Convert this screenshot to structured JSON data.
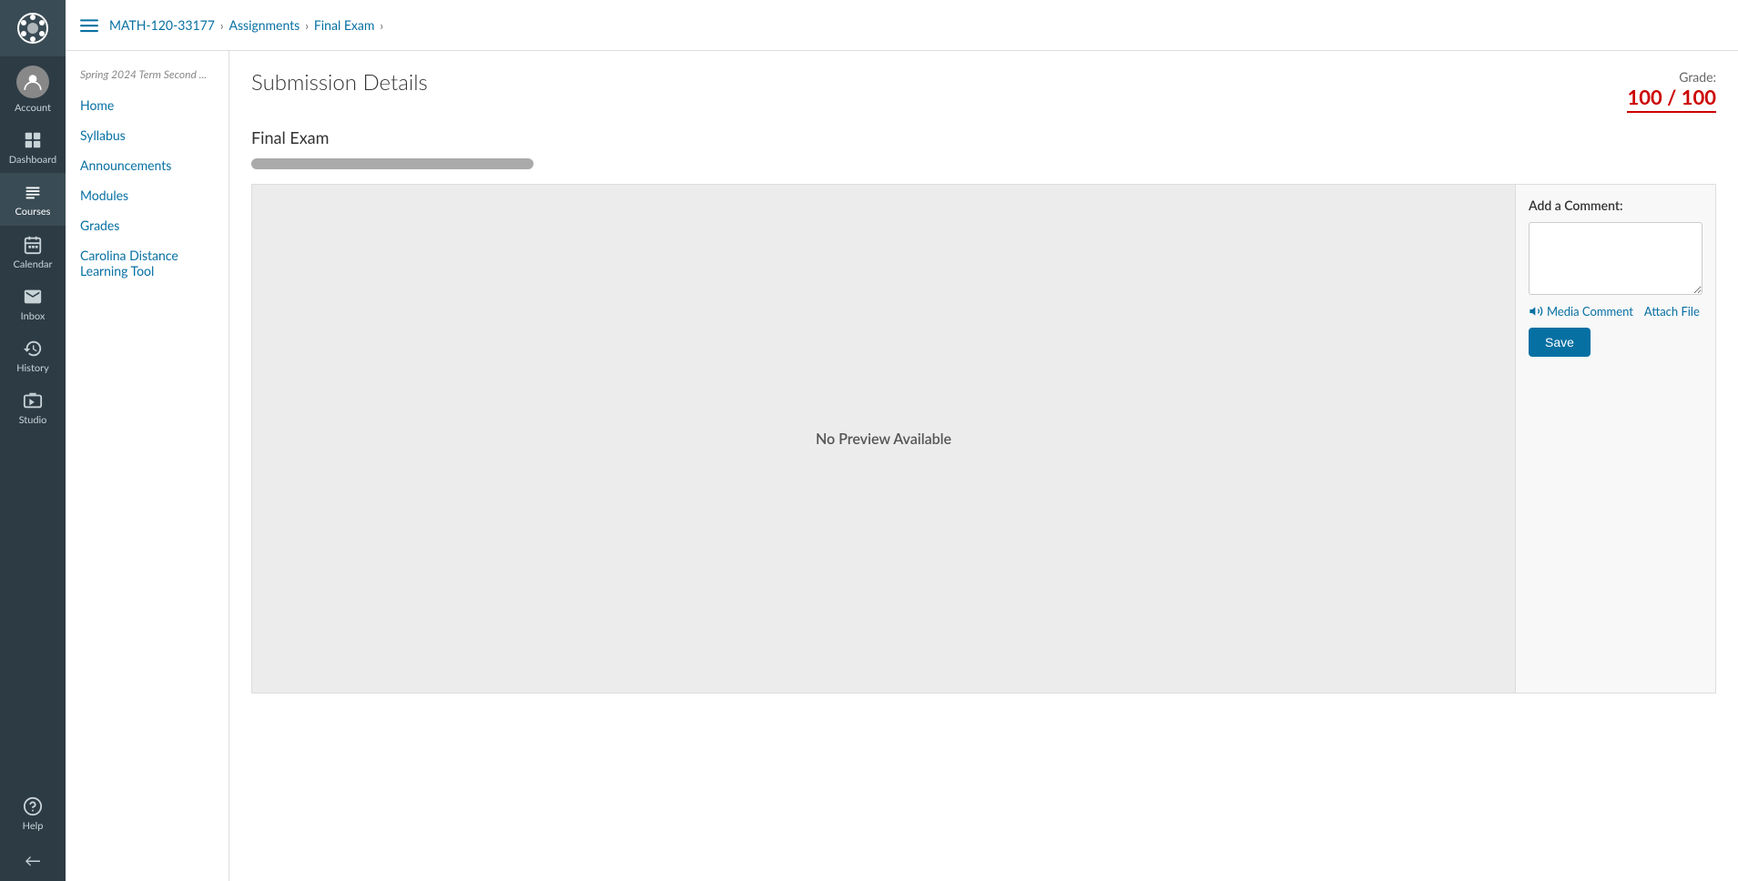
{
  "sidebar": {
    "items": [
      {
        "id": "account",
        "label": "Account",
        "icon": "account"
      },
      {
        "id": "dashboard",
        "label": "Dashboard",
        "icon": "dashboard"
      },
      {
        "id": "courses",
        "label": "Courses",
        "icon": "courses",
        "active": true
      },
      {
        "id": "calendar",
        "label": "Calendar",
        "icon": "calendar"
      },
      {
        "id": "inbox",
        "label": "Inbox",
        "icon": "inbox"
      },
      {
        "id": "history",
        "label": "History",
        "icon": "history"
      },
      {
        "id": "studio",
        "label": "Studio",
        "icon": "studio"
      },
      {
        "id": "help",
        "label": "Help",
        "icon": "help"
      }
    ],
    "collapse_label": "←"
  },
  "topbar": {
    "course_code": "MATH-120-33177",
    "breadcrumbs": [
      {
        "label": "MATH-120-33177",
        "url": "#"
      },
      {
        "label": "Assignments",
        "url": "#"
      },
      {
        "label": "Final Exam",
        "url": "#"
      }
    ]
  },
  "course_nav": {
    "term": "Spring 2024 Term Second ...",
    "items": [
      {
        "label": "Home",
        "url": "#"
      },
      {
        "label": "Syllabus",
        "url": "#"
      },
      {
        "label": "Announcements",
        "url": "#"
      },
      {
        "label": "Modules",
        "url": "#"
      },
      {
        "label": "Grades",
        "url": "#"
      },
      {
        "label": "Carolina Distance Learning Tool",
        "url": "#"
      }
    ]
  },
  "page": {
    "title": "Submission Details",
    "exam_name": "Final Exam",
    "grade_label": "Grade:",
    "grade_value": "100 / 100",
    "no_preview_text": "No Preview Available",
    "comment_section": {
      "label": "Add a Comment:",
      "media_comment_label": "Media Comment",
      "attach_file_label": "Attach File",
      "save_label": "Save"
    }
  }
}
